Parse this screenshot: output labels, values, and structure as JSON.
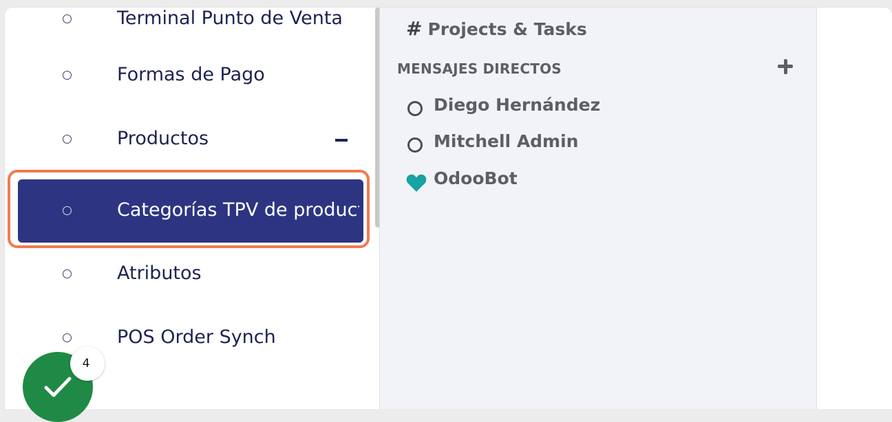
{
  "menu": {
    "items": [
      {
        "label": "Terminal Punto de Venta"
      },
      {
        "label": "Formas de Pago"
      },
      {
        "label": "Productos"
      },
      {
        "label": "Categorías TPV de productos"
      },
      {
        "label": "Atributos"
      },
      {
        "label": "POS Order Synch"
      }
    ]
  },
  "chat": {
    "channel": {
      "hash": "#",
      "label": "Projects & Tasks"
    },
    "section_title": "MENSAJES DIRECTOS",
    "contacts": [
      {
        "name": "Diego Hernández",
        "status": "offline"
      },
      {
        "name": "Mitchell Admin",
        "status": "offline"
      },
      {
        "name": "OdooBot",
        "status": "bot"
      }
    ]
  },
  "onboarding": {
    "count": "4"
  },
  "colors": {
    "active_bg": "#2d3582",
    "focus_ring": "#f07b4f",
    "fab": "#1f8a46",
    "bot_heart": "#17a2a4"
  },
  "icons": {
    "add": "plus-icon",
    "check": "checkmark-icon",
    "bot": "heart-icon",
    "collapse": "minus-icon"
  }
}
